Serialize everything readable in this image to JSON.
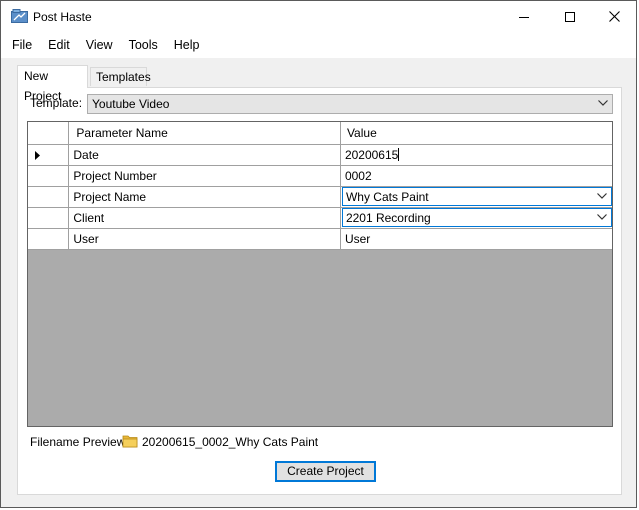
{
  "window": {
    "title": "Post Haste",
    "icon": "app-icon"
  },
  "menu": [
    "File",
    "Edit",
    "View",
    "Tools",
    "Help"
  ],
  "tabs": [
    {
      "label": "New Project",
      "active": true
    },
    {
      "label": "Templates",
      "active": false
    }
  ],
  "template": {
    "label": "Template:",
    "value": "Youtube Video"
  },
  "grid": {
    "headers": {
      "name": "Parameter Name",
      "value": "Value"
    },
    "rows": [
      {
        "name": "Date",
        "value": "20200615",
        "editor": "text",
        "current": true
      },
      {
        "name": "Project Number",
        "value": "0002",
        "editor": "text"
      },
      {
        "name": "Project Name",
        "value": "Why Cats Paint",
        "editor": "combo"
      },
      {
        "name": "Client",
        "value": "2201 Recording",
        "editor": "combo"
      },
      {
        "name": "User",
        "value": "User",
        "editor": "text"
      }
    ]
  },
  "preview": {
    "label": "Filename Preview:",
    "value": "20200615_0002_Why Cats Paint"
  },
  "create_button": "Create Project",
  "colors": {
    "accent": "#0078d7",
    "grid_background": "#ababab",
    "folder": "#e8b739"
  }
}
